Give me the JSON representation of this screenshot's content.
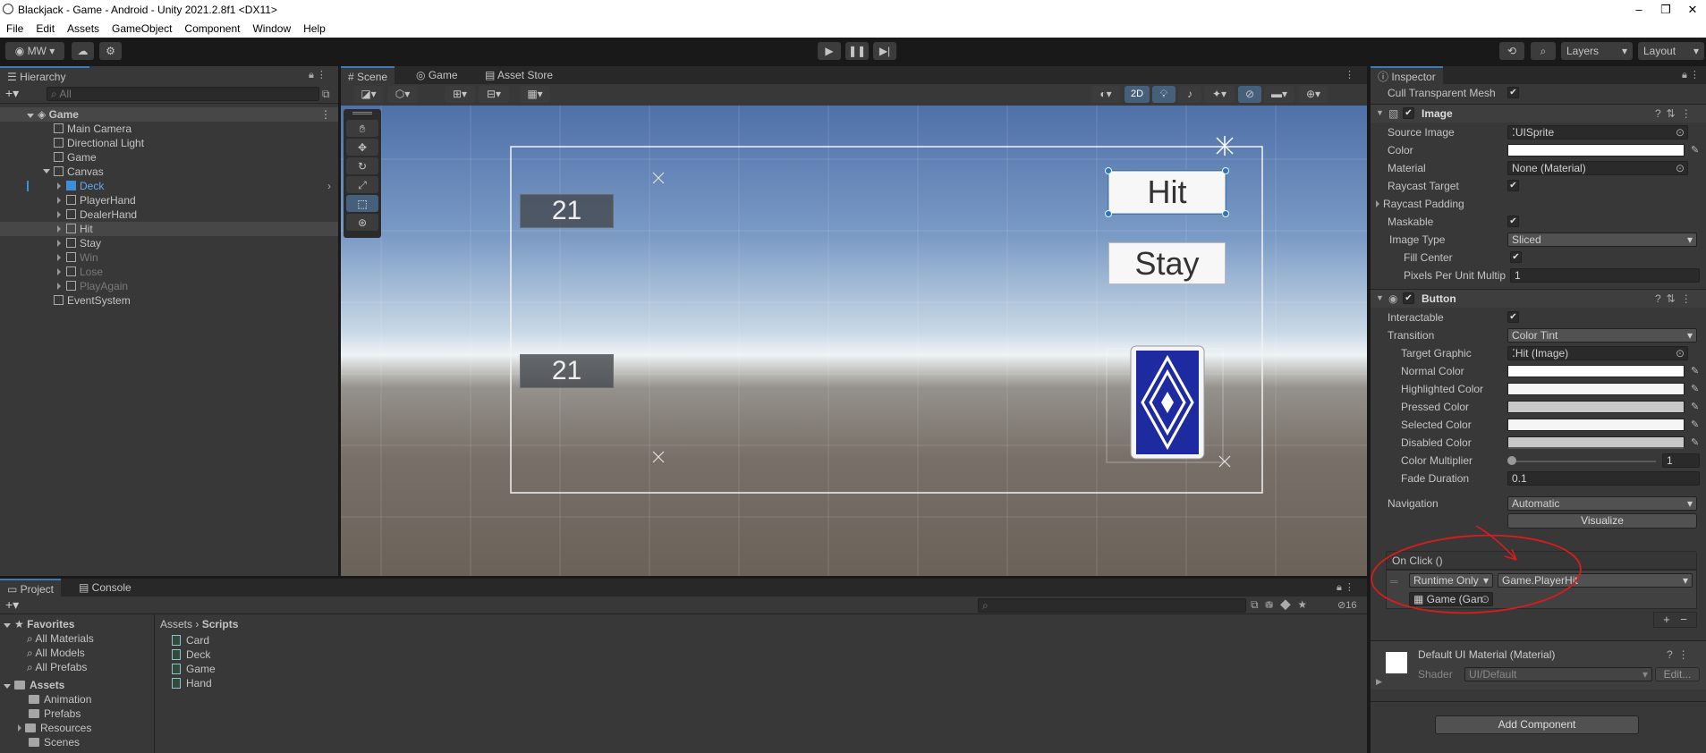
{
  "window": {
    "title": "Blackjack - Game - Android - Unity 2021.2.8f1 <DX11>"
  },
  "menu": [
    "File",
    "Edit",
    "Assets",
    "GameObject",
    "Component",
    "Window",
    "Help"
  ],
  "toolbar": {
    "account": "MW",
    "layers": "Layers",
    "layout": "Layout"
  },
  "hierarchy": {
    "tab": "Hierarchy",
    "search_placeholder": "All",
    "scene": "Game",
    "items": [
      {
        "label": "Main Camera",
        "depth": 1
      },
      {
        "label": "Directional Light",
        "depth": 1
      },
      {
        "label": "Game",
        "depth": 1
      },
      {
        "label": "Canvas",
        "depth": 1
      },
      {
        "label": "Deck",
        "depth": 2
      },
      {
        "label": "PlayerHand",
        "depth": 2
      },
      {
        "label": "DealerHand",
        "depth": 2
      },
      {
        "label": "Hit",
        "depth": 2
      },
      {
        "label": "Stay",
        "depth": 2
      },
      {
        "label": "Win",
        "depth": 2
      },
      {
        "label": "Lose",
        "depth": 2
      },
      {
        "label": "PlayAgain",
        "depth": 2
      },
      {
        "label": "EventSystem",
        "depth": 1
      }
    ]
  },
  "scene_tabs": [
    "Scene",
    "Game",
    "Asset Store"
  ],
  "scene_view": {
    "mode_2d": "2D",
    "dealer_score": "21",
    "player_score": "21",
    "hit_button": "Hit",
    "stay_button": "Stay"
  },
  "project": {
    "tabs": [
      "Project",
      "Console"
    ],
    "favorites_label": "Favorites",
    "favorites": [
      "All Materials",
      "All Models",
      "All Prefabs"
    ],
    "assets_label": "Assets",
    "asset_folders": [
      "Animation",
      "Prefabs",
      "Resources",
      "Scenes"
    ],
    "breadcrumb": [
      "Assets",
      "Scripts"
    ],
    "scripts": [
      "Card",
      "Deck",
      "Game",
      "Hand"
    ],
    "hidden_count": "16"
  },
  "inspector": {
    "tab": "Inspector",
    "cull_transparent_mesh": "Cull Transparent Mesh",
    "image": {
      "title": "Image",
      "source_image_label": "Source Image",
      "source_image": "UISprite",
      "color_label": "Color",
      "material_label": "Material",
      "material": "None (Material)",
      "raycast_target_label": "Raycast Target",
      "raycast_padding_label": "Raycast Padding",
      "maskable_label": "Maskable",
      "image_type_label": "Image Type",
      "image_type": "Sliced",
      "fill_center_label": "Fill Center",
      "ppu_label": "Pixels Per Unit Multip",
      "ppu": "1"
    },
    "button": {
      "title": "Button",
      "interactable_label": "Interactable",
      "transition_label": "Transition",
      "transition": "Color Tint",
      "target_graphic_label": "Target Graphic",
      "target_graphic": "Hit (Image)",
      "normal_color_label": "Normal Color",
      "highlighted_color_label": "Highlighted Color",
      "pressed_color_label": "Pressed Color",
      "selected_color_label": "Selected Color",
      "disabled_color_label": "Disabled Color",
      "color_multiplier_label": "Color Multiplier",
      "color_multiplier": "1",
      "fade_duration_label": "Fade Duration",
      "fade_duration": "0.1",
      "navigation_label": "Navigation",
      "navigation": "Automatic",
      "visualize": "Visualize",
      "on_click_label": "On Click ()",
      "runtime": "Runtime Only",
      "function": "Game.PlayerHit",
      "target_object": "Game (Gan"
    },
    "material_block": {
      "title": "Default UI Material (Material)",
      "shader_label": "Shader",
      "shader": "UI/Default",
      "edit": "Edit..."
    },
    "add_component": "Add Component"
  },
  "colors": {
    "accent": "#3a79bb",
    "annotation": "#d91c1c",
    "card_blue": "#1d2aa0"
  }
}
